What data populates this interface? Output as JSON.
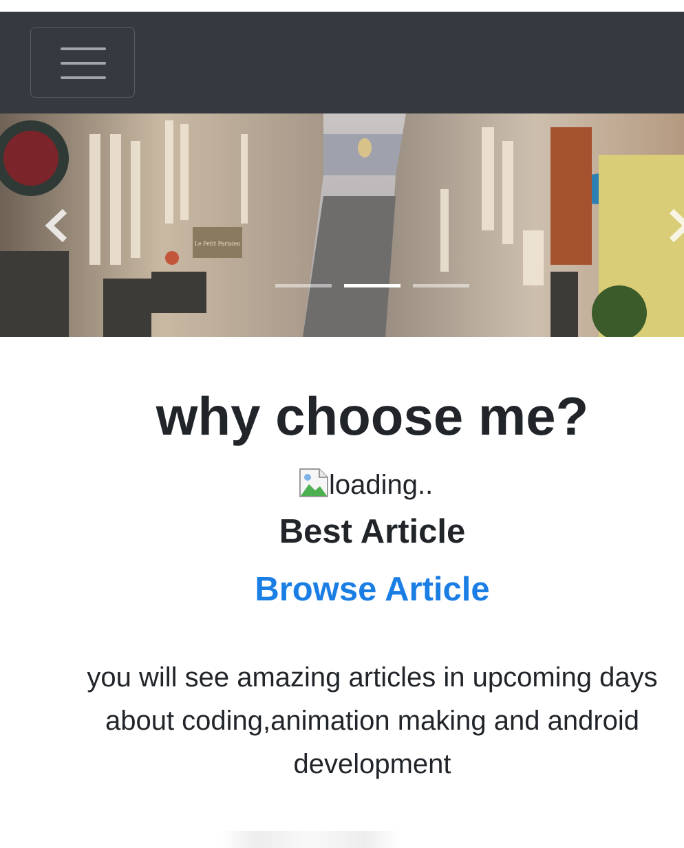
{
  "navbar": {
    "background": "#343a40",
    "toggler_icon": "hamburger-menu-icon"
  },
  "carousel": {
    "slide_count": 3,
    "active_slide": 2,
    "prev_icon": "chevron-left-icon",
    "next_icon": "chevron-right-icon",
    "sign_text": "Le Petit Parisien"
  },
  "content": {
    "heading": "why choose me?",
    "image_alt": "loading..",
    "image_icon": "broken-image-icon",
    "subheading": "Best Article",
    "link_label": "Browse Article",
    "link_color": "#1a7ee4",
    "description": "you will see amazing articles in upcoming days\nabout coding,animation making and android\ndevelopment"
  }
}
